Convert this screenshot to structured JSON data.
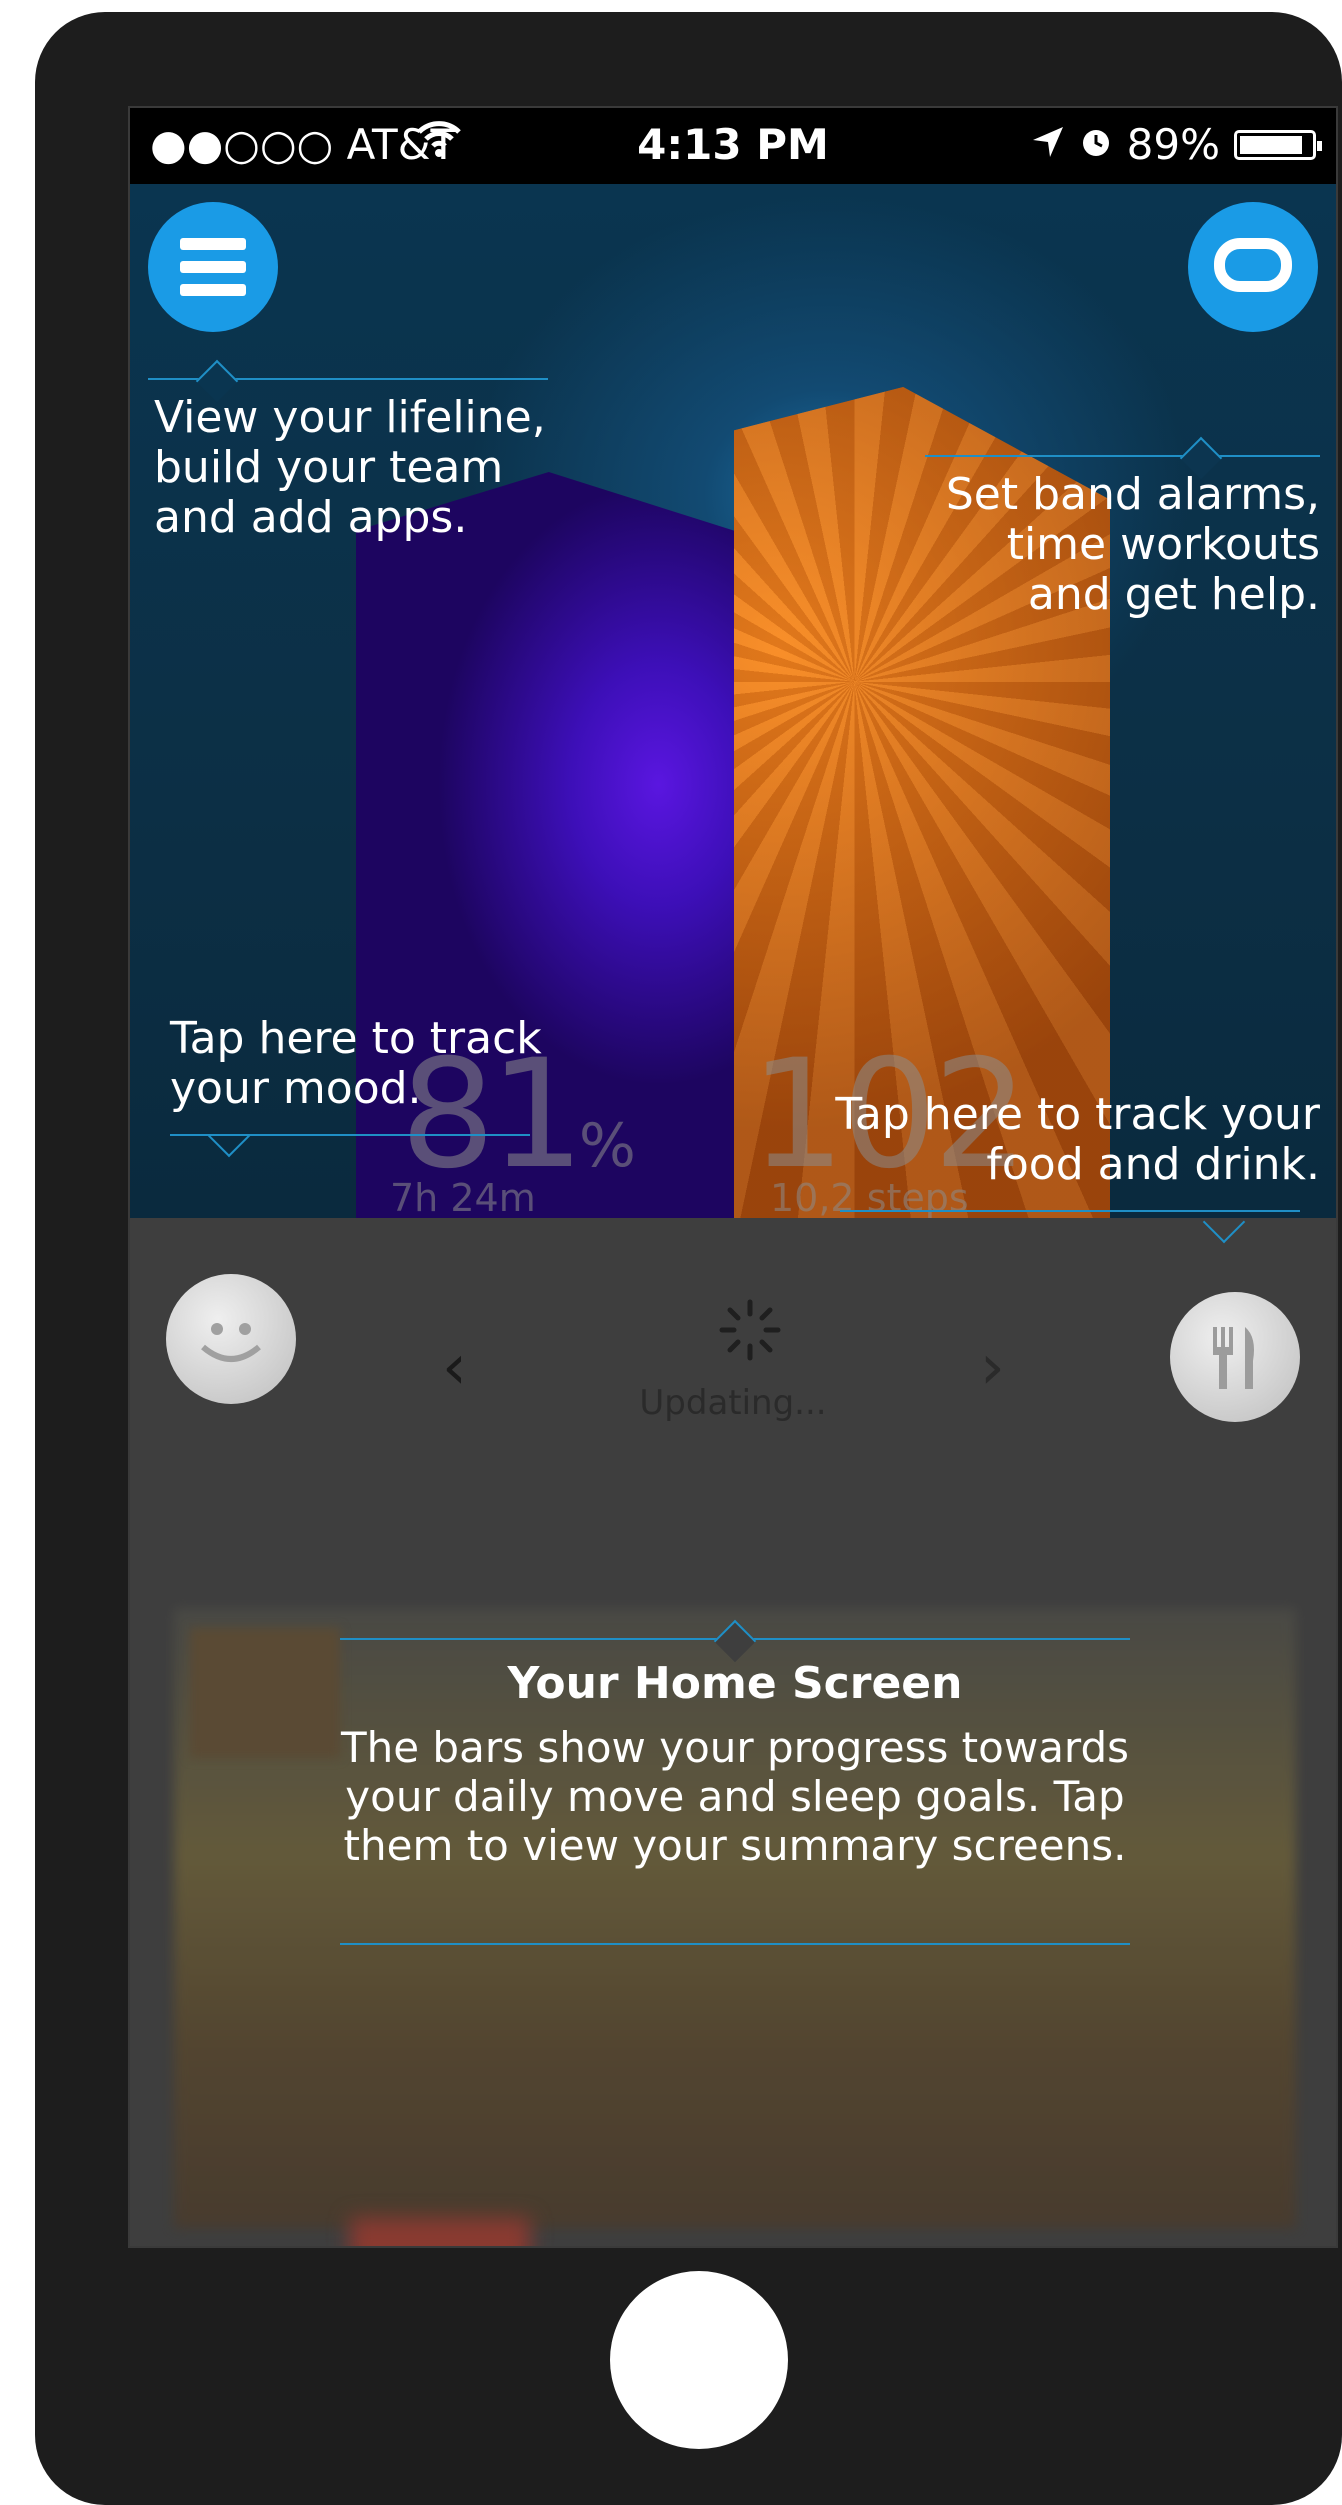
{
  "status_bar": {
    "carrier": "●●○○○ AT&T",
    "wifi_icon": "wifi-icon",
    "time": "4:13 PM",
    "location_icon": "location-arrow-icon",
    "alarm_icon": "alarm-clock-icon",
    "battery": "89%",
    "battery_level": 0.89
  },
  "header": {
    "menu_icon": "hamburger-menu-icon",
    "chat_icon": "speech-bubble-icon"
  },
  "bars": {
    "sleep": {
      "value": "81",
      "unit": "%",
      "duration": "7h 24m",
      "color": "#4a10d0"
    },
    "steps": {
      "value": "102",
      "subtitle": "10,2 steps",
      "color": "#e86f10"
    }
  },
  "tips": {
    "lifeline": "View your lifeline, build your team and add apps.",
    "alarms": "Set band alarms, time workouts and get help.",
    "mood": "Tap here to track your mood.",
    "food": "Tap here to track your food and drink.",
    "home_title": "Your Home Screen",
    "home_body": "The bars show your progress towards your daily move and sleep goals. Tap them to view your summary screens."
  },
  "panel": {
    "mood_icon": "smiley-face-icon",
    "food_icon": "fork-knife-icon",
    "prev_icon": "chevron-left-icon",
    "next_icon": "chevron-right-icon",
    "spinner_icon": "loading-spinner-icon",
    "status": "Updating..."
  },
  "colors": {
    "accent": "#1a9be6",
    "tip_line": "#1f8fc6"
  }
}
